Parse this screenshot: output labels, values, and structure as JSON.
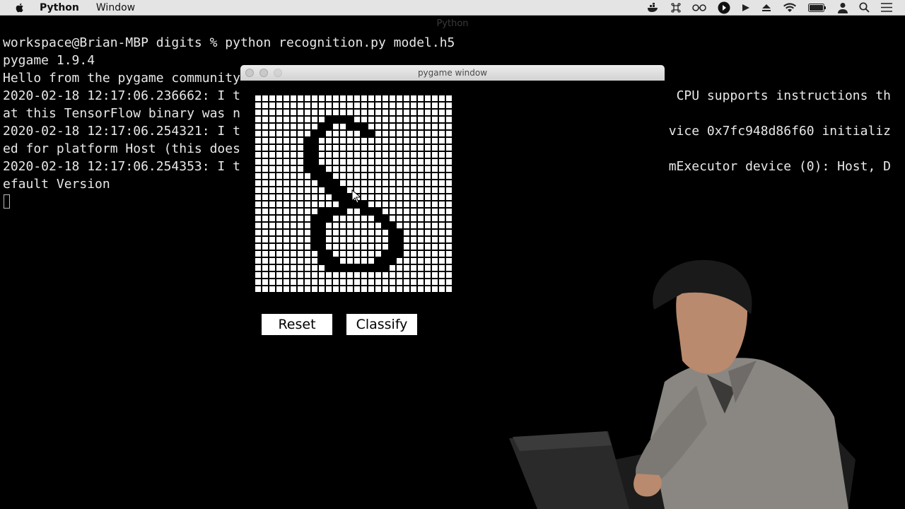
{
  "menubar": {
    "app_name": "Python",
    "menu_items": [
      "Window"
    ],
    "status_icons": [
      "docker-icon",
      "command-icon",
      "glasses-icon",
      "circle-arrow-icon",
      "play-icon",
      "eject-icon",
      "wifi-icon",
      "battery-icon",
      "user-icon",
      "search-icon",
      "list-icon"
    ]
  },
  "terminal": {
    "title": "Python",
    "lines": [
      "workspace@Brian-MBP digits % python recognition.py model.h5",
      "pygame 1.9.4",
      "Hello from the pygame community",
      "2020-02-18 12:17:06.236662: I t",
      "at this TensorFlow binary was n",
      "2020-02-18 12:17:06.254321: I t",
      "ed for platform Host (this does",
      "2020-02-18 12:17:06.254353: I t",
      "efault Version"
    ],
    "right_fragments": [
      "CPU supports instructions th",
      "vice 0x7fc948d86f60 initializ",
      "mExecutor device (0): Host, D"
    ]
  },
  "pygame_window": {
    "title": "pygame window",
    "grid_size": 28,
    "filled_cells": [
      [
        3,
        10
      ],
      [
        3,
        11
      ],
      [
        3,
        12
      ],
      [
        3,
        13
      ],
      [
        4,
        9
      ],
      [
        4,
        10
      ],
      [
        4,
        13
      ],
      [
        4,
        14
      ],
      [
        4,
        15
      ],
      [
        5,
        8
      ],
      [
        5,
        9
      ],
      [
        5,
        15
      ],
      [
        5,
        16
      ],
      [
        6,
        7
      ],
      [
        6,
        8
      ],
      [
        7,
        7
      ],
      [
        7,
        8
      ],
      [
        8,
        7
      ],
      [
        8,
        8
      ],
      [
        9,
        7
      ],
      [
        9,
        8
      ],
      [
        10,
        7
      ],
      [
        10,
        8
      ],
      [
        10,
        9
      ],
      [
        11,
        8
      ],
      [
        11,
        9
      ],
      [
        11,
        10
      ],
      [
        12,
        9
      ],
      [
        12,
        10
      ],
      [
        12,
        11
      ],
      [
        13,
        10
      ],
      [
        13,
        11
      ],
      [
        13,
        12
      ],
      [
        14,
        11
      ],
      [
        14,
        12
      ],
      [
        14,
        13
      ],
      [
        15,
        12
      ],
      [
        15,
        13
      ],
      [
        15,
        14
      ],
      [
        15,
        15
      ],
      [
        16,
        9
      ],
      [
        16,
        10
      ],
      [
        16,
        11
      ],
      [
        16,
        12
      ],
      [
        16,
        15
      ],
      [
        16,
        16
      ],
      [
        16,
        17
      ],
      [
        17,
        8
      ],
      [
        17,
        9
      ],
      [
        17,
        10
      ],
      [
        17,
        17
      ],
      [
        17,
        18
      ],
      [
        18,
        8
      ],
      [
        18,
        9
      ],
      [
        18,
        18
      ],
      [
        18,
        19
      ],
      [
        19,
        8
      ],
      [
        19,
        9
      ],
      [
        19,
        19
      ],
      [
        19,
        20
      ],
      [
        20,
        8
      ],
      [
        20,
        9
      ],
      [
        20,
        19
      ],
      [
        20,
        20
      ],
      [
        21,
        8
      ],
      [
        21,
        9
      ],
      [
        21,
        19
      ],
      [
        21,
        20
      ],
      [
        22,
        9
      ],
      [
        22,
        10
      ],
      [
        22,
        18
      ],
      [
        22,
        19
      ],
      [
        22,
        20
      ],
      [
        23,
        9
      ],
      [
        23,
        10
      ],
      [
        23,
        11
      ],
      [
        23,
        17
      ],
      [
        23,
        18
      ],
      [
        23,
        19
      ],
      [
        24,
        10
      ],
      [
        24,
        11
      ],
      [
        24,
        12
      ],
      [
        24,
        13
      ],
      [
        24,
        14
      ],
      [
        24,
        15
      ],
      [
        24,
        16
      ],
      [
        24,
        17
      ],
      [
        24,
        18
      ]
    ],
    "reset_label": "Reset",
    "classify_label": "Classify"
  }
}
